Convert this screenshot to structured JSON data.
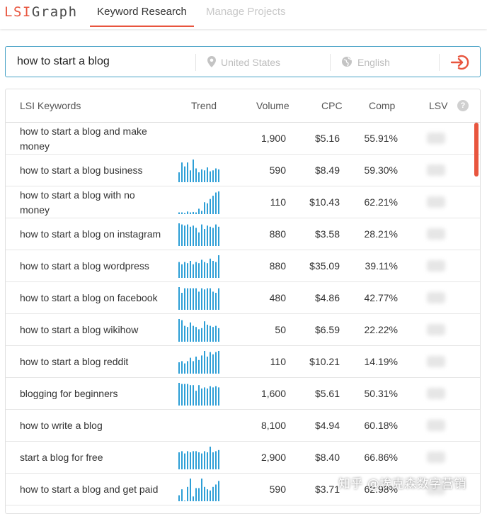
{
  "app": {
    "logo_lsi": "LSI",
    "logo_graph": "Graph"
  },
  "nav": {
    "active_tab": "Keyword Research",
    "inactive_tab": "Manage Projects"
  },
  "search": {
    "query": "how to start a blog",
    "location": "United States",
    "language": "English"
  },
  "colors": {
    "accent": "#e8553e",
    "trend_bar": "#2e9fd6",
    "search_border": "#4aa3c7"
  },
  "icons": {
    "location": "location-pin-icon",
    "language": "globe-icon",
    "go": "arrow-into-circle-icon",
    "help": "question-icon"
  },
  "table": {
    "headers": {
      "keyword": "LSI Keywords",
      "trend": "Trend",
      "volume": "Volume",
      "cpc": "CPC",
      "comp": "Comp",
      "lsv": "LSV",
      "help": "?"
    },
    "rows": [
      {
        "keyword": "how to start a blog and make money",
        "trend": [],
        "volume": "1,900",
        "cpc": "$5.16",
        "comp": "55.91%"
      },
      {
        "keyword": "how to start a blog business",
        "trend": [
          50,
          100,
          80,
          100,
          60,
          115,
          70,
          50,
          65,
          60,
          75,
          55,
          60,
          70,
          65
        ],
        "volume": "590",
        "cpc": "$8.49",
        "comp": "59.30%"
      },
      {
        "keyword": "how to start a blog with no money",
        "trend": [
          8,
          8,
          5,
          12,
          8,
          10,
          8,
          25,
          15,
          55,
          50,
          70,
          85,
          100,
          105
        ],
        "volume": "110",
        "cpc": "$10.43",
        "comp": "62.21%"
      },
      {
        "keyword": "how to start a blog on instagram",
        "trend": [
          100,
          95,
          90,
          95,
          85,
          90,
          80,
          60,
          95,
          75,
          90,
          85,
          80,
          95,
          85
        ],
        "volume": "880",
        "cpc": "$3.58",
        "comp": "28.21%"
      },
      {
        "keyword": "how to start a blog wordpress",
        "trend": [
          70,
          60,
          70,
          65,
          75,
          60,
          70,
          65,
          80,
          70,
          65,
          85,
          75,
          70,
          100
        ],
        "volume": "880",
        "cpc": "$35.09",
        "comp": "39.11%"
      },
      {
        "keyword": "how to start a blog on facebook",
        "trend": [
          100,
          75,
          95,
          95,
          95,
          95,
          95,
          80,
          95,
          90,
          95,
          95,
          80,
          75,
          95
        ],
        "volume": "480",
        "cpc": "$4.86",
        "comp": "42.77%"
      },
      {
        "keyword": "how to start a blog wikihow",
        "trend": [
          100,
          95,
          70,
          65,
          85,
          70,
          65,
          55,
          60,
          90,
          75,
          70,
          65,
          70,
          60
        ],
        "volume": "50",
        "cpc": "$6.59",
        "comp": "22.22%"
      },
      {
        "keyword": "how to start a blog reddit",
        "trend": [
          50,
          55,
          45,
          55,
          70,
          55,
          75,
          60,
          80,
          100,
          75,
          95,
          85,
          95,
          100
        ],
        "volume": "110",
        "cpc": "$10.21",
        "comp": "14.19%"
      },
      {
        "keyword": "blogging for beginners",
        "trend": [
          100,
          95,
          95,
          95,
          90,
          90,
          65,
          90,
          75,
          80,
          75,
          85,
          80,
          85,
          80
        ],
        "volume": "1,600",
        "cpc": "$5.61",
        "comp": "50.31%"
      },
      {
        "keyword": "how to write a blog",
        "trend": [],
        "volume": "8,100",
        "cpc": "$4.94",
        "comp": "60.18%"
      },
      {
        "keyword": "start a blog for free",
        "trend": [
          75,
          80,
          70,
          80,
          75,
          80,
          80,
          75,
          70,
          80,
          75,
          100,
          75,
          80,
          85
        ],
        "volume": "2,900",
        "cpc": "$8.40",
        "comp": "66.86%"
      },
      {
        "keyword": "how to start a blog and get paid",
        "trend": [
          25,
          50,
          0,
          60,
          95,
          20,
          55,
          55,
          95,
          60,
          50,
          45,
          60,
          70,
          85
        ],
        "volume": "590",
        "cpc": "$3.71",
        "comp": "62.98%"
      }
    ]
  },
  "watermark": "知乎 @埃克森数字营销"
}
